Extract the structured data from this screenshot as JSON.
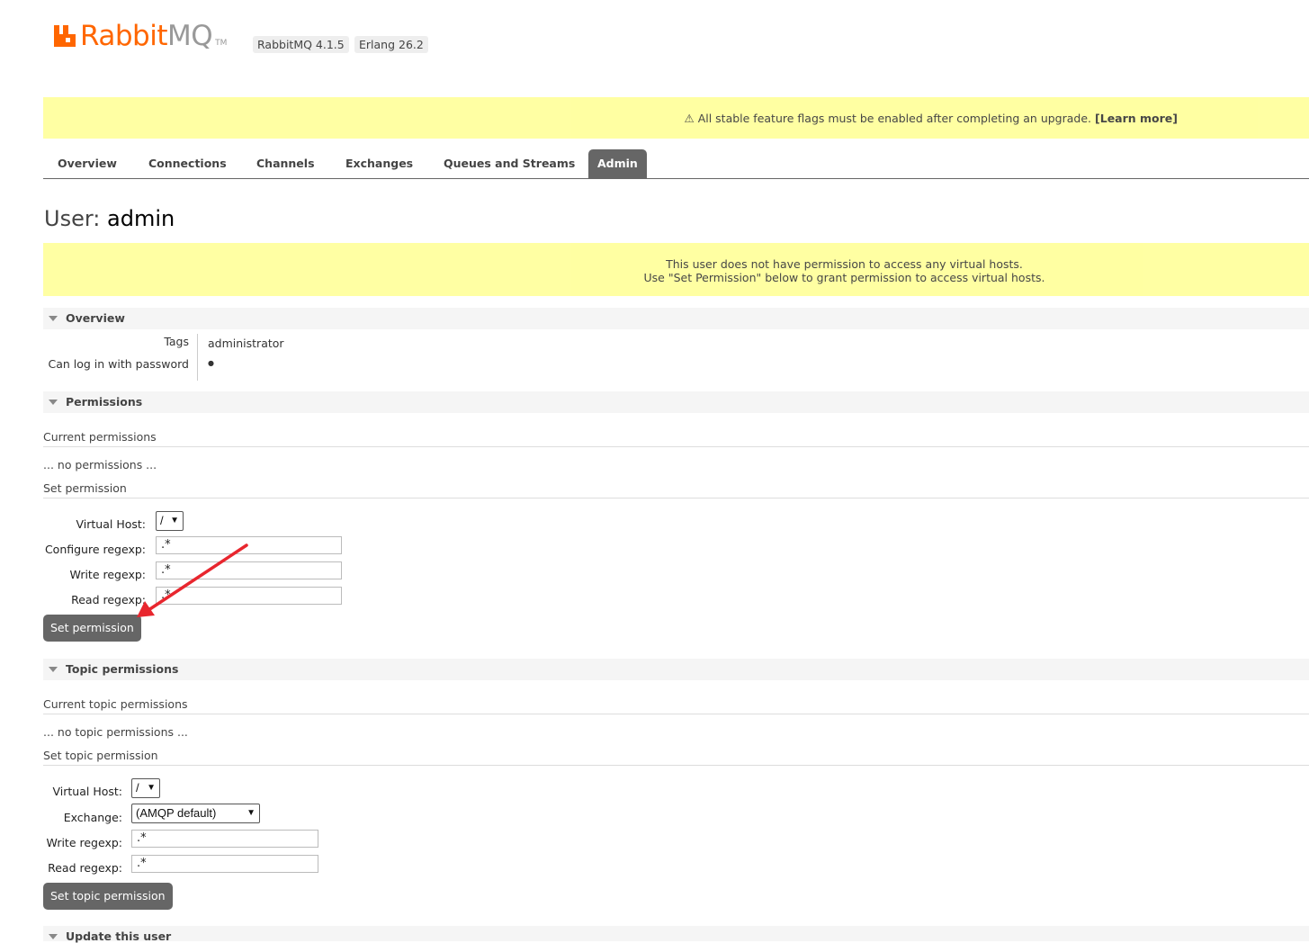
{
  "header": {
    "logo_rabbit": "Rabbit",
    "logo_mq": "MQ",
    "logo_tm": "TM",
    "version": "RabbitMQ 4.1.5",
    "erlang": "Erlang 26.2"
  },
  "upgrade_banner": {
    "text": "⚠ All stable feature flags must be enabled after completing an upgrade.",
    "link": "[Learn more]"
  },
  "tabs": [
    {
      "label": "Overview"
    },
    {
      "label": "Connections"
    },
    {
      "label": "Channels"
    },
    {
      "label": "Exchanges"
    },
    {
      "label": "Queues and Streams"
    },
    {
      "label": "Admin"
    }
  ],
  "page": {
    "title_prefix": "User:",
    "title_name": "admin"
  },
  "noperm_banner": {
    "line1": "This user does not have permission to access any virtual hosts.",
    "line2": "Use \"Set Permission\" below to grant permission to access virtual hosts."
  },
  "overview": {
    "heading": "Overview",
    "tags_label": "Tags",
    "tags_value": "administrator",
    "login_label": "Can log in with password",
    "login_value": "●"
  },
  "permissions": {
    "heading": "Permissions",
    "current_heading": "Current permissions",
    "none_text": "... no permissions ...",
    "set_heading": "Set permission",
    "vhost_label": "Virtual Host:",
    "vhost_value": "/",
    "configure_label": "Configure regexp:",
    "configure_value": ".*",
    "write_label": "Write regexp:",
    "write_value": ".*",
    "read_label": "Read regexp:",
    "read_value": ".*",
    "button": "Set permission"
  },
  "topic_permissions": {
    "heading": "Topic permissions",
    "current_heading": "Current topic permissions",
    "none_text": "... no topic permissions ...",
    "set_heading": "Set topic permission",
    "vhost_label": "Virtual Host:",
    "vhost_value": "/",
    "exchange_label": "Exchange:",
    "exchange_value": "(AMQP default)",
    "write_label": "Write regexp:",
    "write_value": ".*",
    "read_label": "Read regexp:",
    "read_value": ".*",
    "button": "Set topic permission"
  },
  "update_user": {
    "heading": "Update this user"
  },
  "colors": {
    "brand_orange": "#ff6600",
    "banner_yellow": "#ffff99",
    "tab_active": "#666666",
    "annotation_arrow": "#e8262e"
  }
}
